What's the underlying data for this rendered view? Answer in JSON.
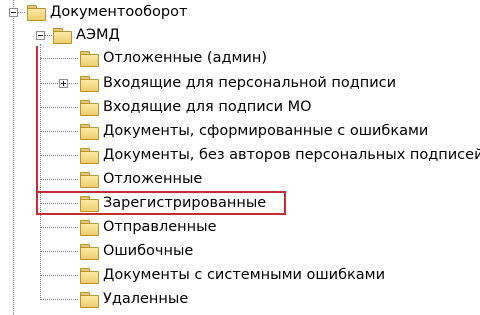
{
  "tree": {
    "root": {
      "label": "Документооборот",
      "icon": "folder-icon",
      "expanded": true
    },
    "aemd": {
      "label": "АЭМД",
      "icon": "folder-icon",
      "expanded": true
    },
    "children": [
      {
        "label": "Отложенные (админ)",
        "icon": "folder-icon",
        "has_children": false
      },
      {
        "label": "Входящие для персональной подписи",
        "icon": "folder-icon",
        "has_children": true
      },
      {
        "label": "Входящие для подписи МО",
        "icon": "folder-icon",
        "has_children": false
      },
      {
        "label": "Документы, сформированные с ошибками",
        "icon": "folder-icon",
        "has_children": false
      },
      {
        "label": "Документы, без авторов персональных подписей",
        "icon": "folder-icon",
        "has_children": false
      },
      {
        "label": "Отложенные",
        "icon": "folder-icon",
        "has_children": false
      },
      {
        "label": "Зарегистрированные",
        "icon": "folder-icon",
        "has_children": false,
        "highlighted": true
      },
      {
        "label": "Отправленные",
        "icon": "folder-icon",
        "has_children": false
      },
      {
        "label": "Ошибочные",
        "icon": "folder-icon",
        "has_children": false
      },
      {
        "label": "Документы с системными ошибками",
        "icon": "folder-icon",
        "has_children": false
      },
      {
        "label": "Удаленные",
        "icon": "folder-icon",
        "has_children": false
      }
    ],
    "highlight_color": "#c32c35",
    "folder_color": "#f0cf6e"
  }
}
